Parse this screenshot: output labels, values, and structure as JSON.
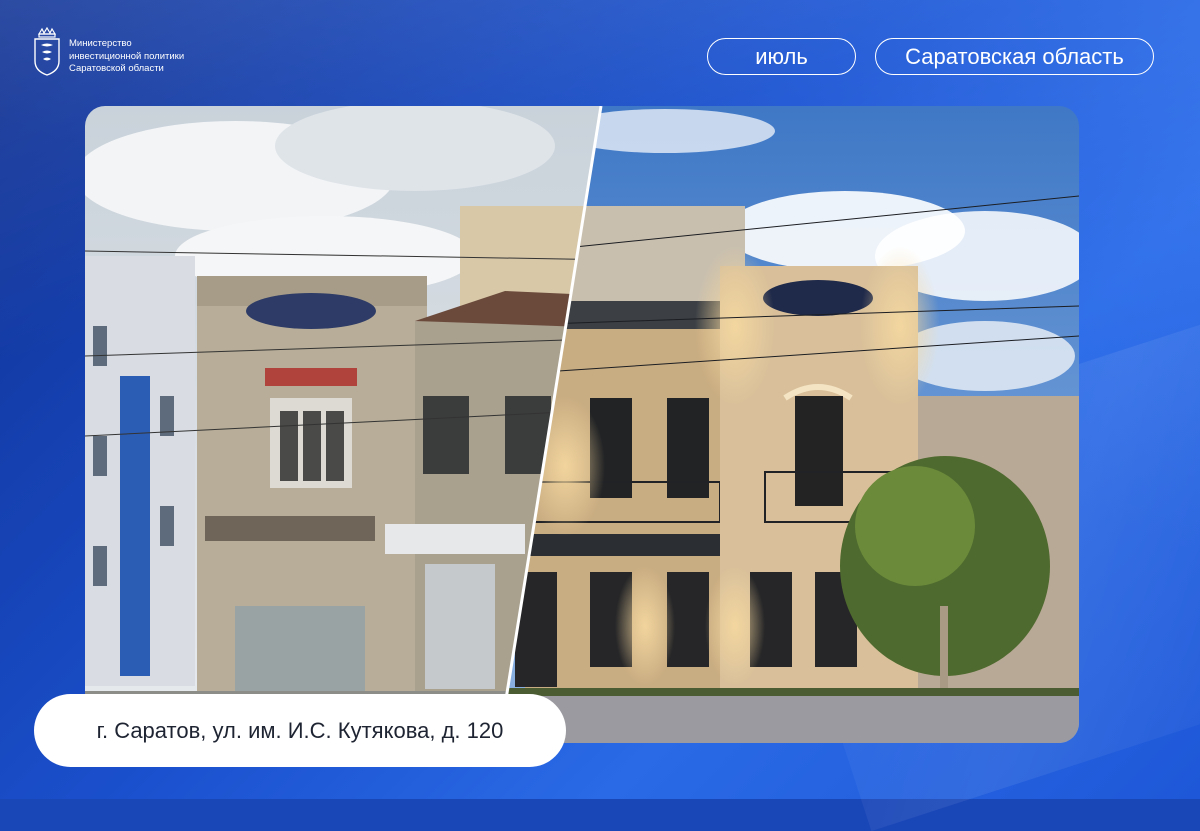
{
  "ministry": {
    "lines": [
      "Министерство",
      "инвестиционной политики",
      "Саратовской области"
    ],
    "crest_icon": "saratov-coat-of-arms-icon"
  },
  "header": {
    "month": "июль",
    "region": "Саратовская область"
  },
  "photo": {
    "before_icon": "dilapidated-building-photo",
    "after_icon": "restored-building-photo"
  },
  "address": "г. Саратов, ул. им. И.С. Кутякова, д. 120",
  "colors": {
    "background": "#1a4fcc",
    "pill_border": "#ffffff",
    "label_bg": "#ffffff",
    "label_text": "#1e2432"
  }
}
